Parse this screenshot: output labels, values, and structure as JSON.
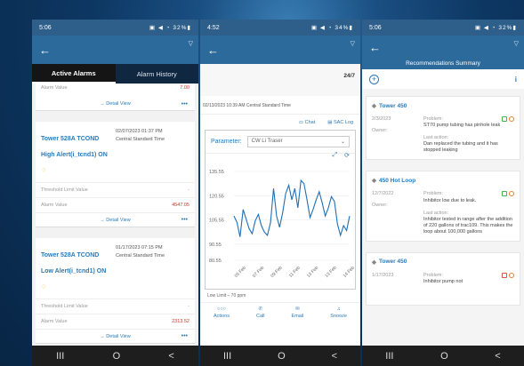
{
  "phone1": {
    "time": "5:06",
    "status_icons": "▣ ◀ ◔ 32%▮",
    "tabs": [
      "Active Alarms",
      "Alarm History"
    ],
    "partial_label": "Alarm Value",
    "partial_value": "7.00",
    "detail_view": "Detail View",
    "more": "•••",
    "alarm1": {
      "title": "Tower 528A TCOND High Alert(i_tcnd1) ON",
      "date": "02/07/2023 01:37 PM",
      "tz": "Central Standard Time",
      "threshold_label": "Threshold Limit Value",
      "threshold_value": "-",
      "value_label": "Alarm Value",
      "value": "4547.05"
    },
    "alarm2": {
      "title": "Tower 528A TCOND Low Alert(i_tcnd1) ON",
      "date": "01/17/2023 07:15 PM",
      "tz": "Central Standard Time",
      "threshold_label": "Threshold Limit Value",
      "threshold_value": "-",
      "value_label": "Alarm Value",
      "value": "2313.52"
    }
  },
  "phone2": {
    "time": "4:52",
    "status_icons": "▣ ◀ ◔ 34%▮",
    "title_right": "24/7",
    "timestamp": "02/13/2023 10:39 AM  Central Standard Time",
    "chat": "Chat",
    "saclog": "SAC Log",
    "param_label": "Parameter:",
    "param_value": "CW Li Traser",
    "low_limit": "Low Limit – 70 ppm",
    "bottom": [
      "Actions",
      "Call",
      "Email",
      "Snooze"
    ]
  },
  "chart_data": {
    "type": "line",
    "ylim": [
      80.55,
      135.55
    ],
    "yticks": [
      "135.55",
      "120.55",
      "105.55",
      "90.55",
      "80.55"
    ],
    "xticks": [
      "05 Feb",
      "07 Feb",
      "09 Feb",
      "11 Feb",
      "13 Feb",
      "13 Feb",
      "14 Feb"
    ],
    "values": [
      108,
      104,
      95,
      112,
      106,
      100,
      97,
      105,
      109,
      102,
      98,
      96,
      104,
      125,
      108,
      101,
      110,
      122,
      127,
      118,
      125,
      113,
      130,
      128,
      118,
      107,
      112,
      118,
      123,
      116,
      108,
      113,
      120,
      117,
      103,
      96,
      102,
      99,
      108
    ]
  },
  "phone3": {
    "time": "5:06",
    "status_icons": "▣ ◀ ◔ 32%▮",
    "title": "Recommendations Summary",
    "rec1": {
      "tower": "Tower 450",
      "date": "2/3/2023",
      "owner_label": "Owner:",
      "problem_label": "Problem:",
      "problem": "ST70 pump tubing has pinhole leak",
      "action_label": "Last action:",
      "action": "Dan replaced the tubing and it has stopped leaking"
    },
    "rec2": {
      "tower": "450 Hot Loop",
      "date": "12/7/2022",
      "owner_label": "Owner:",
      "problem_label": "Problem:",
      "problem": "Inhibitor low due to leak.",
      "action_label": "Last action:",
      "action": "Inhibitor tested in range after the addition of 220 gallons of trac109. This makes the loop about 100,000 gallons"
    },
    "rec3": {
      "tower": "Tower 450",
      "date": "1/17/2023",
      "problem_label": "Problem:",
      "problem": "Inhibitor pump not"
    }
  },
  "nav": [
    "III",
    "O",
    "<"
  ],
  "colors": {
    "accent": "#2a7ab8",
    "alarm_red": "#c0392b",
    "header": "#2d6a9c"
  }
}
